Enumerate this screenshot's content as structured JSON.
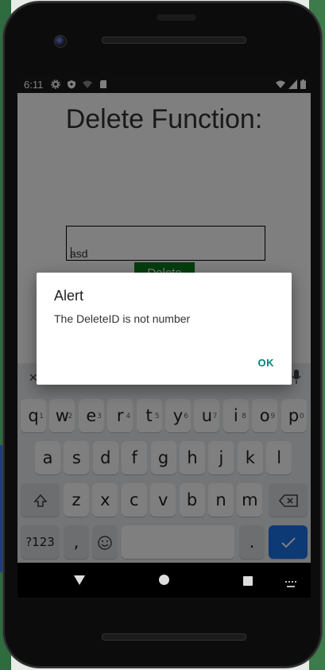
{
  "status_bar": {
    "time": "6:11"
  },
  "app": {
    "title": "Delete Function:",
    "input_value": "asd",
    "delete_button": "Delete"
  },
  "dialog": {
    "title": "Alert",
    "message": "The DeleteID is not number",
    "ok_button": "OK"
  },
  "keyboard": {
    "row1": [
      {
        "key": "q",
        "hint": "1"
      },
      {
        "key": "w",
        "hint": "2"
      },
      {
        "key": "e",
        "hint": "3"
      },
      {
        "key": "r",
        "hint": "4"
      },
      {
        "key": "t",
        "hint": "5"
      },
      {
        "key": "y",
        "hint": "6"
      },
      {
        "key": "u",
        "hint": "7"
      },
      {
        "key": "i",
        "hint": "8"
      },
      {
        "key": "o",
        "hint": "9"
      },
      {
        "key": "p",
        "hint": "0"
      }
    ],
    "row2": [
      "a",
      "s",
      "d",
      "f",
      "g",
      "h",
      "j",
      "k",
      "l"
    ],
    "row3": [
      "z",
      "x",
      "c",
      "v",
      "b",
      "n",
      "m"
    ],
    "symbols_key": "?123",
    "comma_key": ",",
    "period_key": ".",
    "emoji_icon": "emoji-icon",
    "shift_icon": "shift-icon",
    "backspace_icon": "backspace-icon",
    "enter_icon": "checkmark-icon"
  },
  "colors": {
    "delete_button": "#0b7a1d",
    "dialog_accent": "#008577",
    "enter_key": "#1a73e8"
  }
}
